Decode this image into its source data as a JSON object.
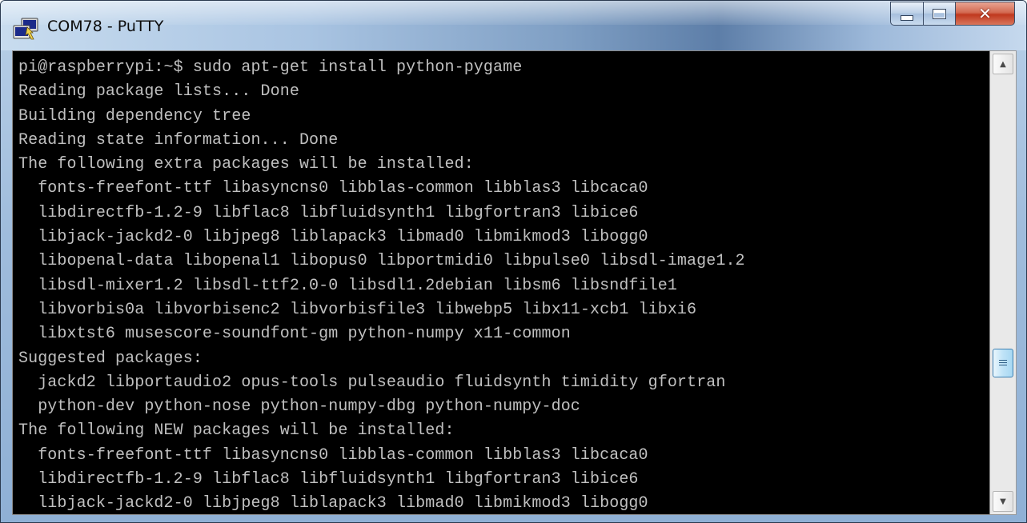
{
  "window": {
    "title": "COM78 - PuTTY",
    "icon": "putty-icon",
    "caption_buttons": {
      "minimize": "minimize-icon",
      "maximize": "maximize-icon",
      "close": "✕"
    }
  },
  "terminal": {
    "background": "#000000",
    "foreground": "#c0c0c0",
    "lines": [
      "pi@raspberrypi:~$ sudo apt-get install python-pygame",
      "Reading package lists... Done",
      "Building dependency tree",
      "Reading state information... Done",
      "The following extra packages will be installed:",
      "  fonts-freefont-ttf libasyncns0 libblas-common libblas3 libcaca0",
      "  libdirectfb-1.2-9 libflac8 libfluidsynth1 libgfortran3 libice6",
      "  libjack-jackd2-0 libjpeg8 liblapack3 libmad0 libmikmod3 libogg0",
      "  libopenal-data libopenal1 libopus0 libportmidi0 libpulse0 libsdl-image1.2",
      "  libsdl-mixer1.2 libsdl-ttf2.0-0 libsdl1.2debian libsm6 libsndfile1",
      "  libvorbis0a libvorbisenc2 libvorbisfile3 libwebp5 libx11-xcb1 libxi6",
      "  libxtst6 musescore-soundfont-gm python-numpy x11-common",
      "Suggested packages:",
      "  jackd2 libportaudio2 opus-tools pulseaudio fluidsynth timidity gfortran",
      "  python-dev python-nose python-numpy-dbg python-numpy-doc",
      "The following NEW packages will be installed:",
      "  fonts-freefont-ttf libasyncns0 libblas-common libblas3 libcaca0",
      "  libdirectfb-1.2-9 libflac8 libfluidsynth1 libgfortran3 libice6",
      "  libjack-jackd2-0 libjpeg8 liblapack3 libmad0 libmikmod3 libogg0"
    ]
  },
  "scrollbar": {
    "up_arrow": "▲",
    "down_arrow": "▼",
    "thumb_icon": "grip-icon"
  }
}
